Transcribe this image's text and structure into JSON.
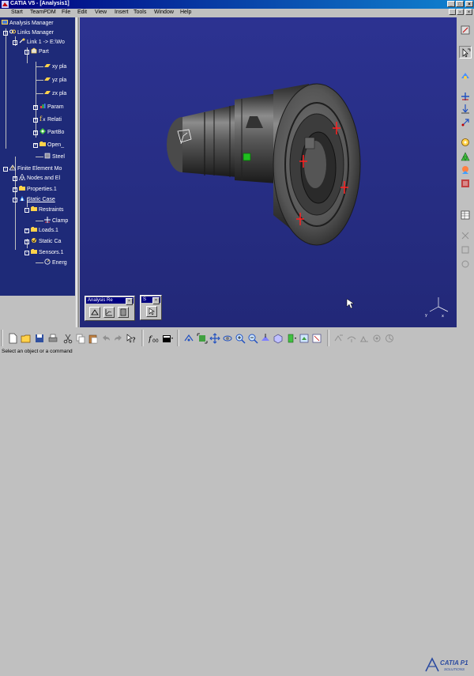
{
  "window": {
    "title": "CATIA V5 - [Analysis1]",
    "min": "_",
    "max": "□",
    "close": "×"
  },
  "menu": [
    "Start",
    "TeamPDM",
    "File",
    "Edit",
    "View",
    "Insert",
    "Tools",
    "Window",
    "Help"
  ],
  "tree": {
    "root": "Analysis Manager",
    "links_manager": "Links Manager",
    "link": "Link 1 -> E:\\Wo",
    "part": "Part",
    "xy": "xy pla",
    "yz": "yz pla",
    "zx": "zx pla",
    "params": "Param",
    "relations": "Relati",
    "partbody": "PartBo",
    "openbody": "Open_",
    "steel": "Steel",
    "fem": "Finite Element Mo",
    "nodes": "Nodes and El",
    "properties": "Properties.1",
    "static_case": "Static Case",
    "restraints": "Restraints",
    "clamp": "Clamp",
    "loads": "Loads.1",
    "static_solution": "Static Ca",
    "sensors": "Sensors.1",
    "energy": "Energ"
  },
  "floating": {
    "analysis_title": "Analysis Re",
    "small_title": "S"
  },
  "status": "Select an object or a command",
  "logo": {
    "brand": "CATIA P1",
    "sub": "SOLUTIONS"
  },
  "colors": {
    "viewport_bg": "#262d82",
    "tree_bg": "#1e2a78",
    "title_bar": "#000080",
    "restraint": "#ff2020",
    "load_marker": "#20c020"
  }
}
